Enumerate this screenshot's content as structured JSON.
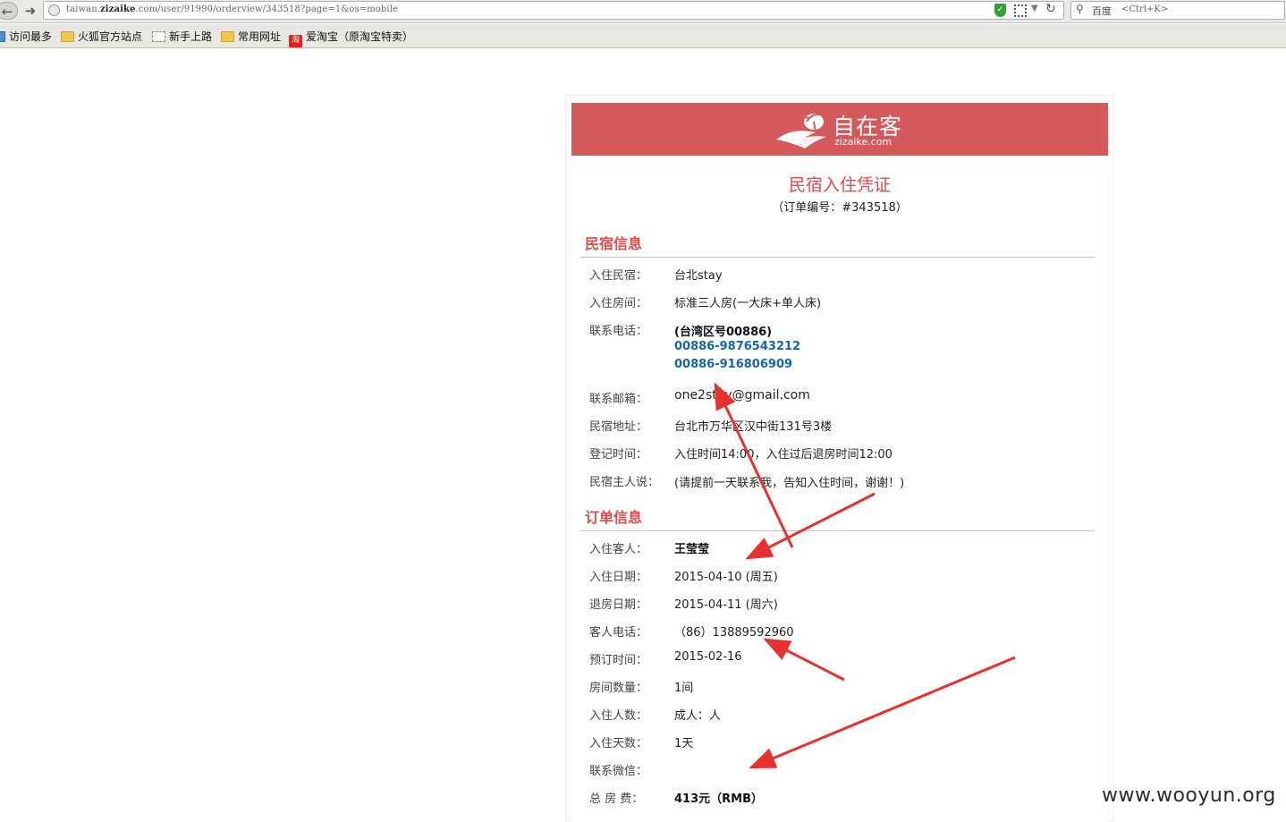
{
  "browser": {
    "url_prefix": "taiwan.",
    "url_domain": "zizaike",
    "url_suffix": ".com/user/91990/orderview/343518?page=1&os=mobile",
    "search_engine": "百度",
    "search_placeholder": "<Ctrl+K>",
    "icons": [
      "back-icon",
      "forward-icon",
      "globe-icon",
      "shield-icon",
      "qr-code-icon",
      "dropdown-icon",
      "reload-icon",
      "search-icon"
    ]
  },
  "bookmarks": [
    {
      "label": "访问最多",
      "icon": "most-visited-icon"
    },
    {
      "label": "火狐官方站点",
      "icon": "folder-icon"
    },
    {
      "label": "新手上路",
      "icon": "page-icon"
    },
    {
      "label": "常用网址",
      "icon": "folder-icon"
    },
    {
      "label": "爱淘宝（原淘宝特卖）",
      "icon": "taobao-icon",
      "icon_text": "淘"
    }
  ],
  "logo": {
    "cn": "自在客",
    "en": "zizaike.com",
    "header_color": "#d4595a"
  },
  "voucher": {
    "title": "民宿入住凭证",
    "order_no": "（订单编号：#343518）"
  },
  "homestay": {
    "heading": "民宿信息",
    "rows": [
      {
        "label": "入住民宿：",
        "value": "台北stay"
      },
      {
        "label": "入住房间：",
        "value": "标准三人房(一大床+单人床)"
      },
      {
        "label": "联系电话：",
        "value": "(台湾区号00886)",
        "phones": [
          "00886-9876543212",
          "00886-916806909"
        ]
      },
      {
        "label": "联系邮箱：",
        "value": "one2stay@gmail.com"
      },
      {
        "label": "民宿地址：",
        "value": "台北市万华区汉中街131号3楼"
      },
      {
        "label": "登记时间：",
        "value": "入住时间14:00，入住过后退房时间12:00"
      },
      {
        "label": "民宿主人说：",
        "value": "(请提前一天联系我，告知入住时间，谢谢！)"
      }
    ]
  },
  "order": {
    "heading": "订单信息",
    "rows": [
      {
        "label": "入住客人：",
        "value": "王莹莹"
      },
      {
        "label": "入住日期：",
        "value": "2015-04-10 (周五)"
      },
      {
        "label": "退房日期：",
        "value": "2015-04-11 (周六)"
      },
      {
        "label": "客人电话：",
        "value": "（86）13889592960"
      },
      {
        "label": "预订时间：",
        "value": "2015-02-16"
      },
      {
        "label": "房间数量：",
        "value": "1间"
      },
      {
        "label": "入住人数：",
        "value": "成人：人"
      },
      {
        "label": "入住天数：",
        "value": "1天"
      },
      {
        "label": "联系微信：",
        "value": ""
      },
      {
        "label": "总 房 费：",
        "value": "413元（RMB）"
      }
    ]
  },
  "annotation_color": "#e8312e",
  "watermark": "www.wooyun.org"
}
